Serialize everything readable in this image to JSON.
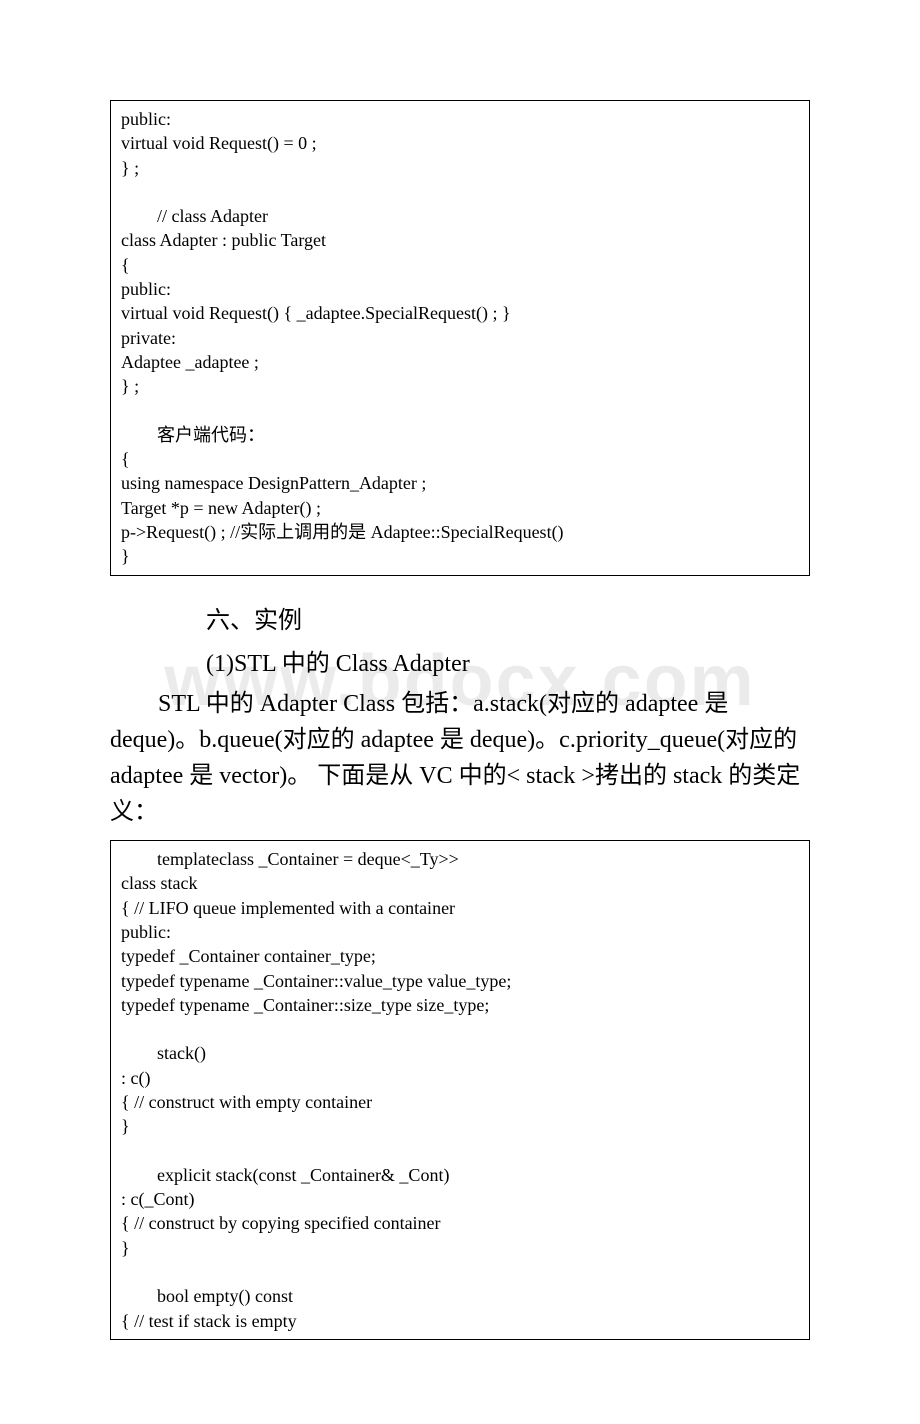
{
  "watermark": "www.bdocx.com",
  "codebox1": {
    "l1": "public:",
    "l2": "virtual void Request() = 0 ;",
    "l3": "} ;",
    "l4": "",
    "l5": "　　// class Adapter",
    "l6": "class Adapter : public Target",
    "l7": "{",
    "l8": "public:",
    "l9": "virtual void Request() { _adaptee.SpecialRequest() ; }",
    "l10": "private:",
    "l11": "Adaptee _adaptee ;",
    "l12": "} ;",
    "l13": "",
    "l14": "　　客户端代码：",
    "l15": "{",
    "l16": "using namespace DesignPattern_Adapter ;",
    "l17": "Target *p = new Adapter() ;",
    "l18": "p->Request() ; //实际上调用的是 Adaptee::SpecialRequest()",
    "l19": "}",
    "l20": ""
  },
  "heading1": "　　六、实例",
  "heading2": "　　(1)STL 中的 Class Adapter",
  "paragraph": "STL 中的 Adapter Class 包括：a.stack(对应的 adaptee 是 deque)。b.queue(对应的 adaptee 是 deque)。c.priority_queue(对应的 adaptee 是 vector)。 下面是从 VC 中的< stack >拷出的 stack 的类定义：",
  "codebox2": {
    "l1": "　　templateclass _Container = deque<_Ty>>",
    "l2": "class stack",
    "l3": "{ // LIFO queue implemented with a container",
    "l4": "public:",
    "l5": "typedef _Container container_type;",
    "l6": "typedef typename _Container::value_type value_type;",
    "l7": "typedef typename _Container::size_type size_type;",
    "l8": "",
    "l9": "　　stack()",
    "l10": ": c()",
    "l11": "{ // construct with empty container",
    "l12": "}",
    "l13": "",
    "l14": "　　explicit stack(const _Container& _Cont)",
    "l15": ": c(_Cont)",
    "l16": "{ // construct by copying specified container",
    "l17": "}",
    "l18": "",
    "l19": "　　bool empty() const",
    "l20": "{ // test if stack is empty"
  }
}
